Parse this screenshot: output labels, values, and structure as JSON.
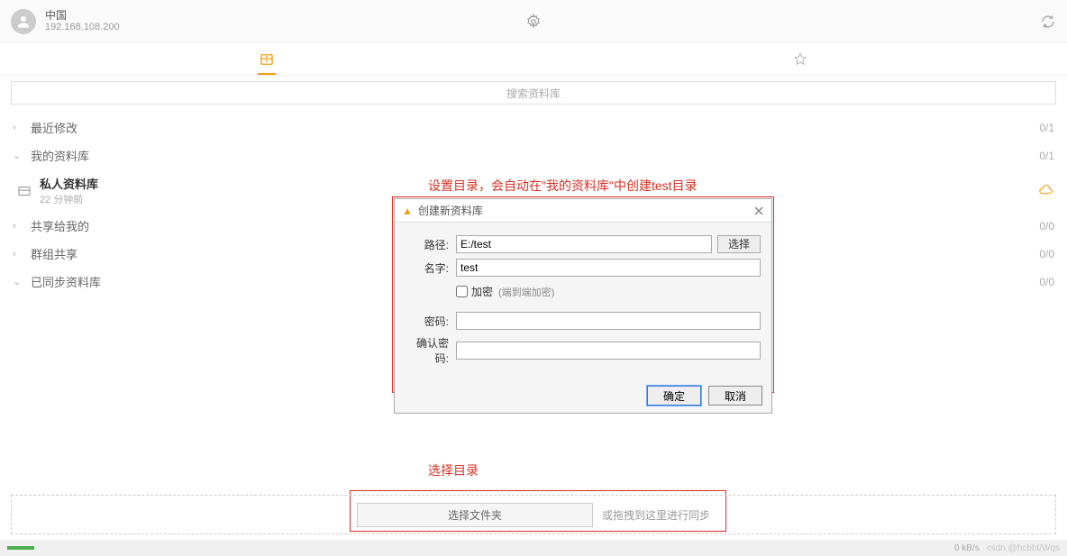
{
  "header": {
    "user_name": "中国",
    "user_ip": "192.168.108.200"
  },
  "search": {
    "placeholder": "搜索资料库"
  },
  "sidebar": {
    "items": [
      {
        "label": "最近修改",
        "count": "0/1",
        "chev": "›"
      },
      {
        "label": "我的资料库",
        "count": "0/1",
        "chev": "⌄"
      },
      {
        "label": "共享给我的",
        "count": "0/0",
        "chev": "›"
      },
      {
        "label": "群组共享",
        "count": "0/0",
        "chev": "›"
      },
      {
        "label": "已同步资料库",
        "count": "0/0",
        "chev": "⌄"
      }
    ],
    "sub": {
      "title": "私人资料库",
      "time": "22 分钟前"
    }
  },
  "annotations": {
    "top": "设置目录，会自动在\"我的资料库\"中创建test目录",
    "bottom": "选择目录"
  },
  "dialog": {
    "title": "创建新资料库",
    "path_label": "路径:",
    "path_value": "E:/test",
    "browse": "选择",
    "name_label": "名字:",
    "name_value": "test",
    "encrypt_label": "加密",
    "encrypt_hint": "(端到端加密)",
    "password_label": "密码:",
    "confirm_label": "确认密码:",
    "ok": "确定",
    "cancel": "取消"
  },
  "dropzone": {
    "button": "选择文件夹",
    "hint": "或拖拽到这里进行同步"
  },
  "status": {
    "speed": "0 kB/s",
    "watermark": "csdn @hcbbt/Wqs"
  }
}
